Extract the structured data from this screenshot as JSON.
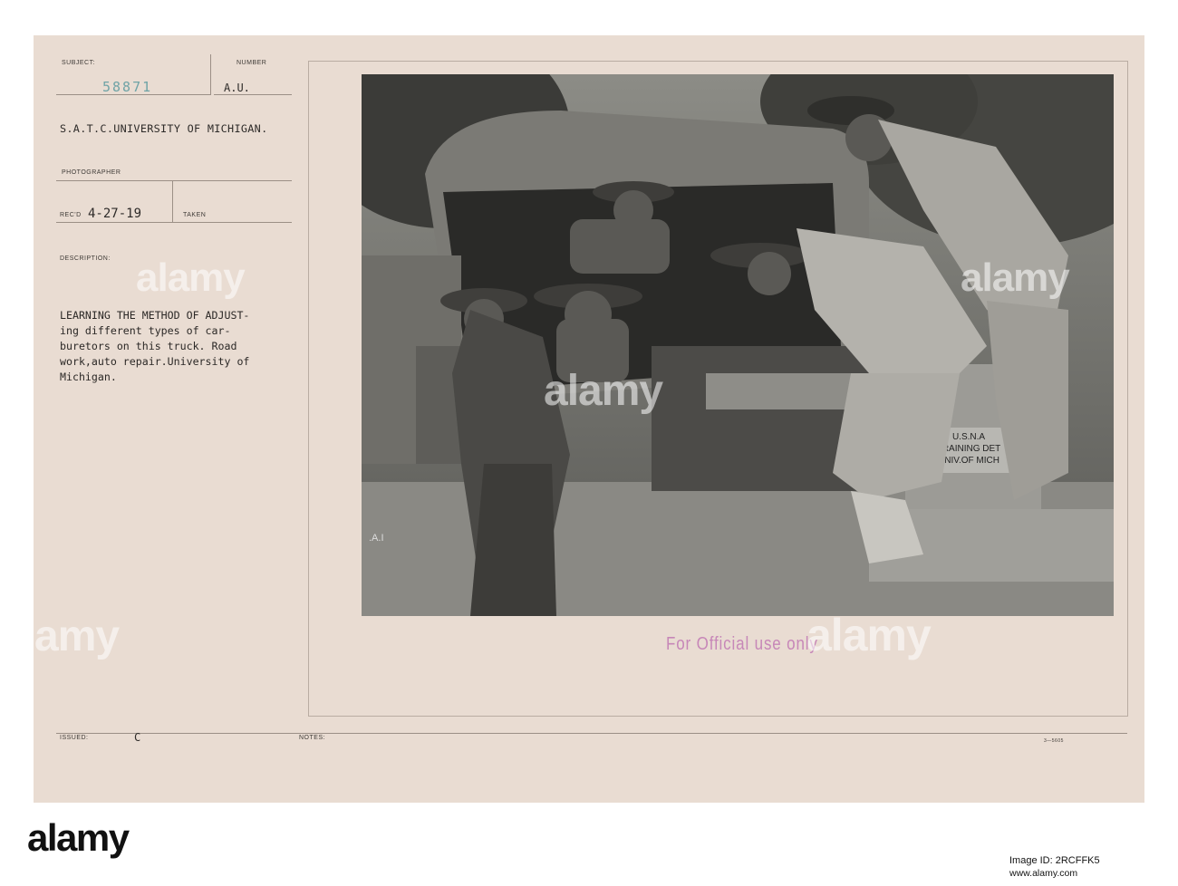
{
  "record": {
    "subject_label": "SUBJECT:",
    "subject_number": "58871",
    "number_label": "NUMBER",
    "number_value": "A.U.",
    "unit": "S.A.T.C.UNIVERSITY OF MICHIGAN.",
    "photographer_label": "PHOTOGRAPHER",
    "recd_label": "REC'D",
    "recd_date": "4-27-19",
    "taken_label": "TAKEN",
    "description_label": "DESCRIPTION:",
    "description_lines": [
      "LEARNING THE METHOD OF ADJUST-",
      "ing different types of car-",
      "buretors on this truck. Road",
      "work,auto repair.University of",
      "Michigan."
    ],
    "issued_label": "ISSUED:",
    "issued_value": "C",
    "notes_label": "NOTES:",
    "form_number": "3—5605"
  },
  "photo": {
    "radiator_sign_lines": [
      "U.S.N.A",
      "TRAINING DET",
      "UNIV.OF MICH"
    ],
    "plate_mark": ".A.I"
  },
  "stamp": {
    "text": "For Official use only"
  },
  "watermark": {
    "text": "alamy"
  },
  "footer": {
    "logo": "alamy",
    "image_id": "Image ID: 2RCFFK5",
    "url": "www.alamy.com"
  },
  "colors": {
    "card": "#e9dcd2",
    "stamp": "#c787b8",
    "subject_number": "#6fa3a6",
    "ink": "#2e2b29"
  }
}
